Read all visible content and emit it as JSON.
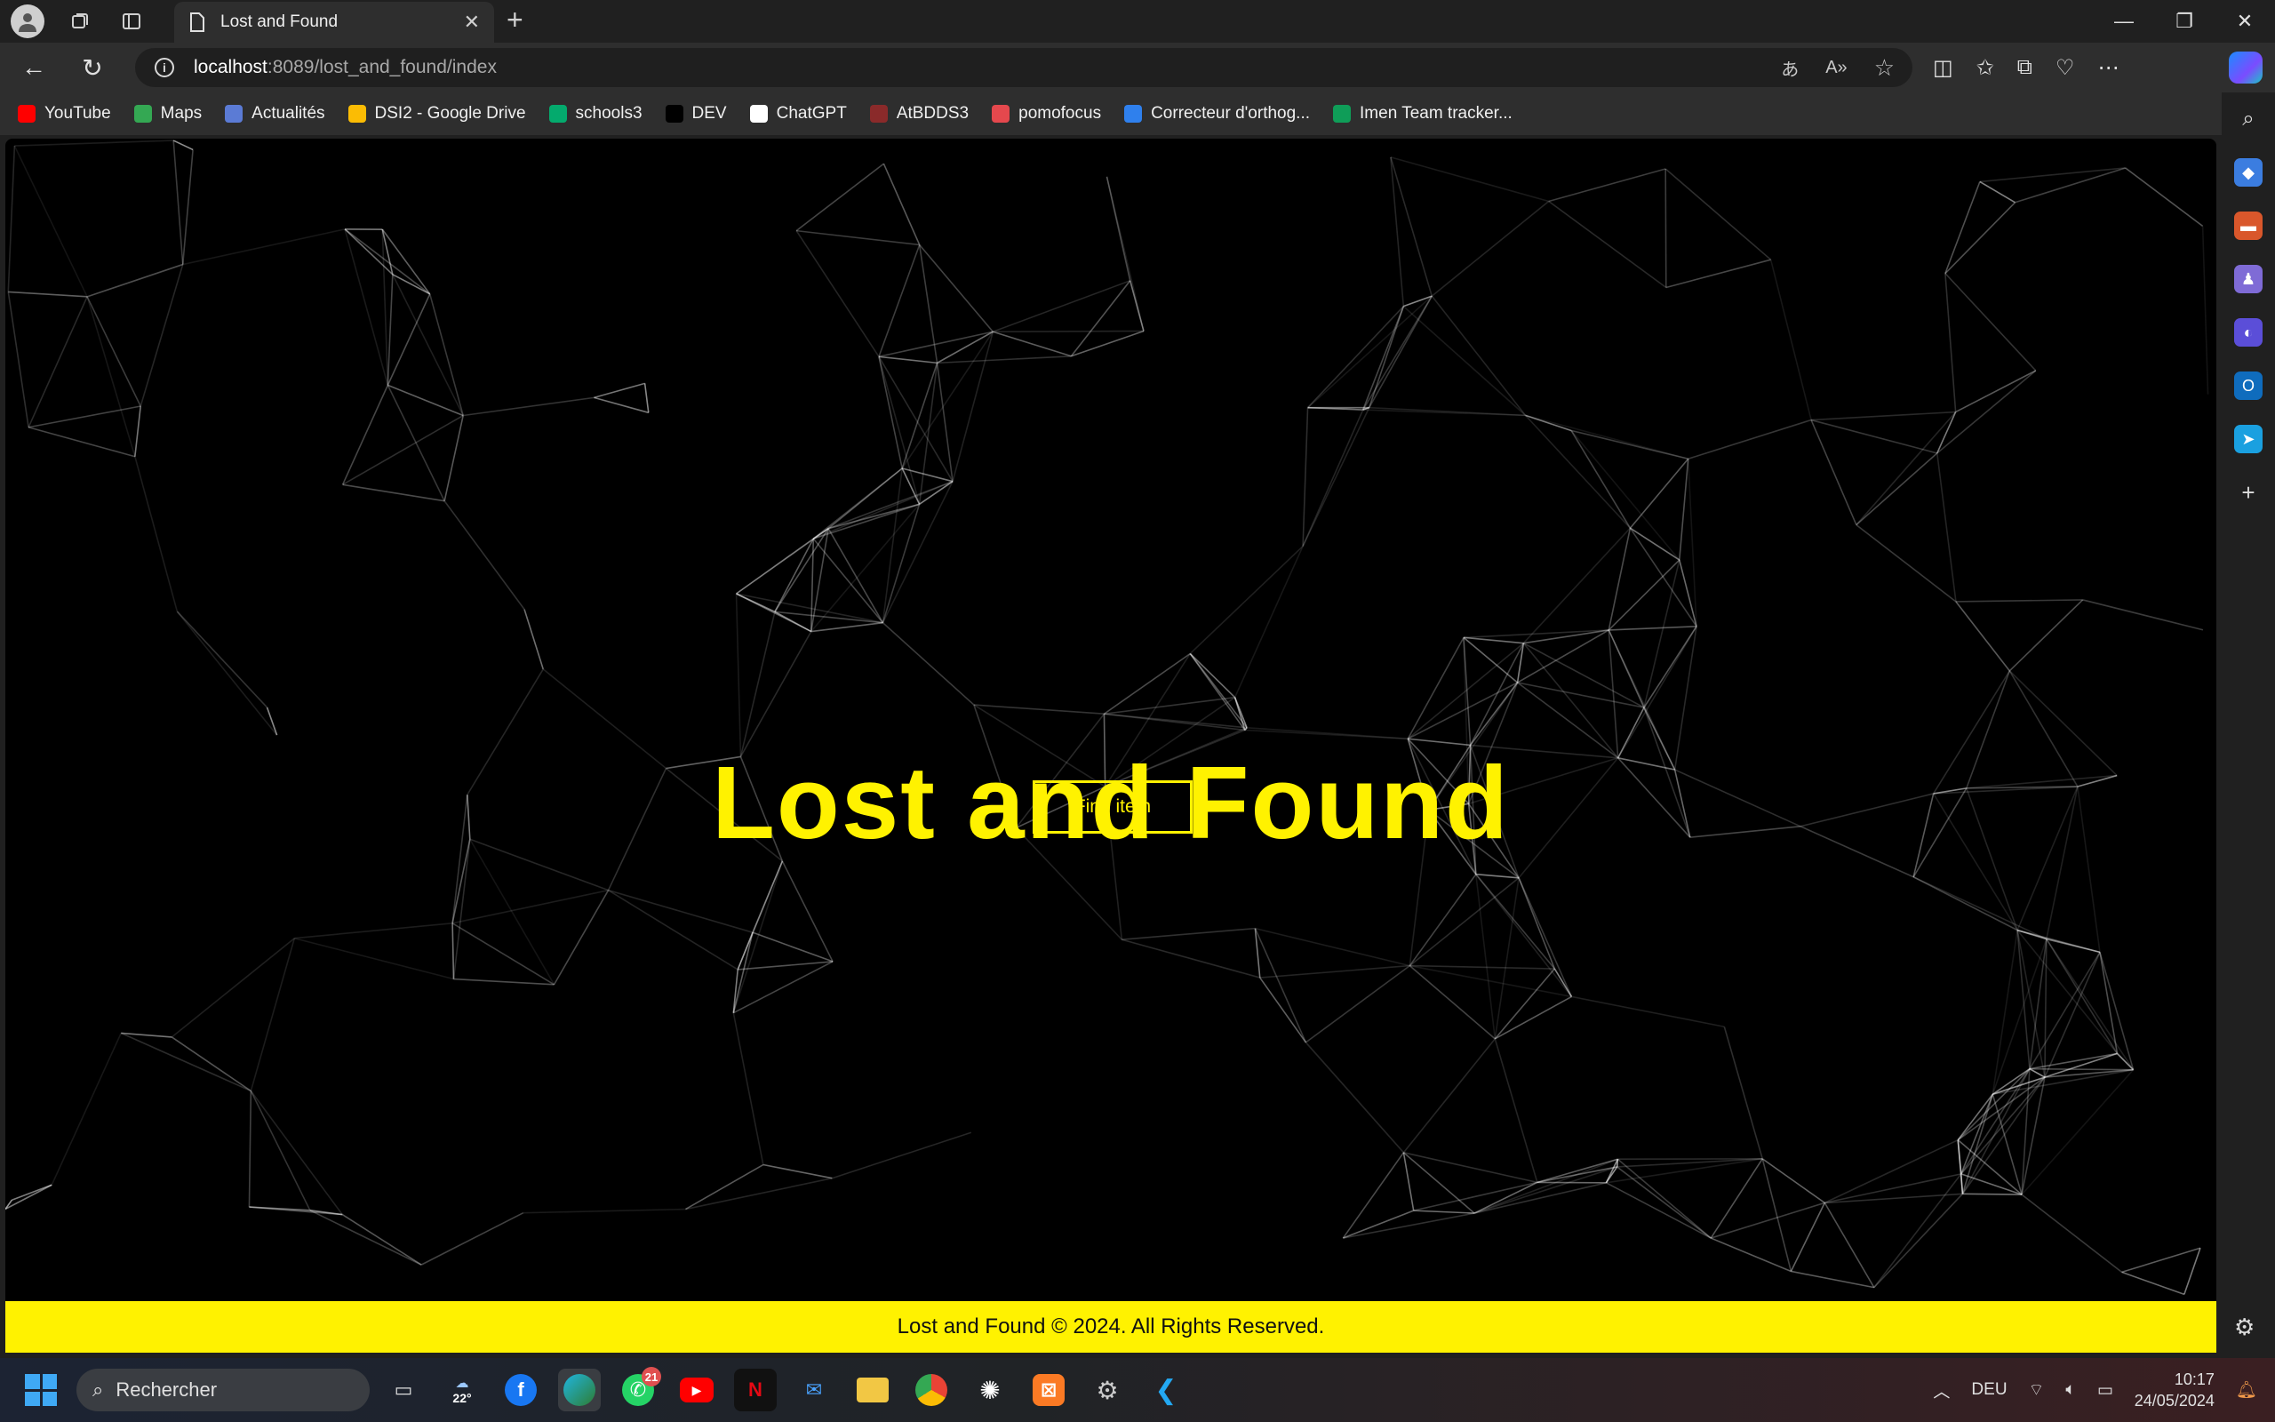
{
  "browser": {
    "tab_title": "Lost and Found",
    "url_host": "localhost",
    "url_path": ":8089/lost_and_found/index"
  },
  "bookmarks": [
    {
      "label": "YouTube",
      "icon": "youtube-icon",
      "color": "#ff0000"
    },
    {
      "label": "Maps",
      "icon": "maps-icon",
      "color": "#34a853"
    },
    {
      "label": "Actualités",
      "icon": "news-icon",
      "color": "#5b7bd5"
    },
    {
      "label": "DSI2 - Google Drive",
      "icon": "drive-icon",
      "color": "#fbbc04"
    },
    {
      "label": "schools3",
      "icon": "w3schools-icon",
      "color": "#04aa6d"
    },
    {
      "label": "DEV",
      "icon": "dev-icon",
      "color": "#000000"
    },
    {
      "label": "ChatGPT",
      "icon": "chatgpt-icon",
      "color": "#ffffff"
    },
    {
      "label": "AtBDDS3",
      "icon": "atbdds-icon",
      "color": "#8a2a2a"
    },
    {
      "label": "pomofocus",
      "icon": "pomofocus-icon",
      "color": "#e5484d"
    },
    {
      "label": "Correcteur d'orthog...",
      "icon": "correcteur-icon",
      "color": "#2f80ed"
    },
    {
      "label": "Imen Team tracker...",
      "icon": "sheets-icon",
      "color": "#0f9d58"
    }
  ],
  "page": {
    "title": "Lost and Found",
    "find_button": "Find item",
    "footer": "Lost and Found © 2024. All Rights Reserved."
  },
  "taskbar": {
    "search_placeholder": "Rechercher",
    "weather": "22°",
    "whatsapp_badge": "21",
    "language": "DEU",
    "time": "10:17",
    "date": "24/05/2024"
  },
  "colors": {
    "accent_yellow": "#fff200",
    "page_bg": "#000000"
  }
}
